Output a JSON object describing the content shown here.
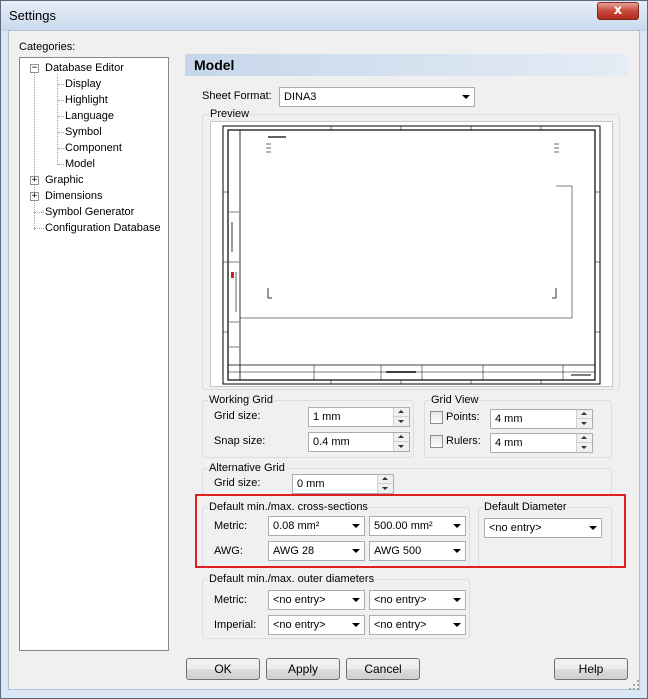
{
  "window": {
    "title": "Settings",
    "close_symbol": "x"
  },
  "categories": {
    "label": "Categories:",
    "items": [
      {
        "label": "Database Editor",
        "expander": "−"
      },
      {
        "label": "Display"
      },
      {
        "label": "Highlight"
      },
      {
        "label": "Language"
      },
      {
        "label": "Symbol"
      },
      {
        "label": "Component"
      },
      {
        "label": "Model"
      },
      {
        "label": "Graphic",
        "expander": "+"
      },
      {
        "label": "Dimensions",
        "expander": "+"
      },
      {
        "label": "Symbol Generator"
      },
      {
        "label": "Configuration Database"
      }
    ]
  },
  "header": {
    "title": "Model"
  },
  "sheet_format": {
    "label": "Sheet Format:",
    "value": "DINA3"
  },
  "preview": {
    "label": "Preview"
  },
  "working_grid": {
    "title": "Working Grid",
    "grid_size_label": "Grid size:",
    "grid_size": "1 mm",
    "snap_size_label": "Snap size:",
    "snap_size": "0.4 mm"
  },
  "grid_view": {
    "title": "Grid View",
    "points_label": "Points:",
    "points_value": "4 mm",
    "rulers_label": "Rulers:",
    "rulers_value": "4 mm"
  },
  "alternative_grid": {
    "title": "Alternative Grid",
    "grid_size_label": "Grid size:",
    "grid_size": "0 mm"
  },
  "cross_sections": {
    "title": "Default min./max. cross-sections",
    "metric_label": "Metric:",
    "metric_min": "0.08 mm²",
    "metric_max": "500.00 mm²",
    "awg_label": "AWG:",
    "awg_min": "AWG 28",
    "awg_max": "AWG 500"
  },
  "default_diameter": {
    "title": "Default Diameter",
    "value": "<no entry>"
  },
  "outer_diameters": {
    "title": "Default min./max. outer diameters",
    "metric_label": "Metric:",
    "metric_min": "<no entry>",
    "metric_max": "<no entry>",
    "imperial_label": "Imperial:",
    "imperial_min": "<no entry>",
    "imperial_max": "<no entry>"
  },
  "buttons": {
    "ok": "OK",
    "apply": "Apply",
    "cancel": "Cancel",
    "help": "Help"
  },
  "colors": {
    "highlight_frame": "#e02020",
    "title_bar": "#c9d9ed",
    "close_button": "#c8473a"
  }
}
